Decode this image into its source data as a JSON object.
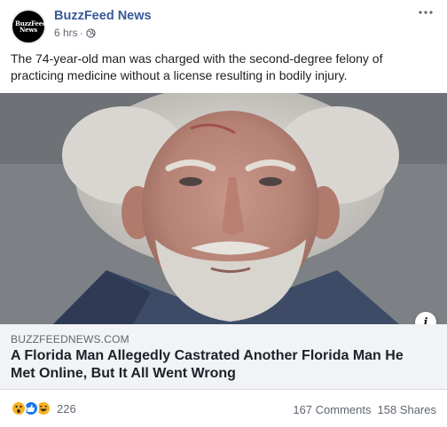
{
  "post": {
    "page_name": "BuzzFeed News",
    "avatar_text": "BuzzFeed News",
    "time": "6 hrs",
    "separator": "·",
    "audience_icon": "globe-icon",
    "more_icon": "more-options-icon",
    "caption": "The 74-year-old man was charged with the second-degree felony of practicing medicine without a license resulting in bodily injury."
  },
  "link": {
    "domain": "BUZZFEEDNEWS.COM",
    "title": "A Florida Man Allegedly Castrated Another Florida Man He Met Online, But It All Went Wrong",
    "info_icon": "i"
  },
  "engagement": {
    "reactions": [
      "wow",
      "like",
      "haha"
    ],
    "reaction_count": "226",
    "comments": "167 Comments",
    "shares": "158 Shares"
  },
  "colors": {
    "page_name": "#385898",
    "meta_text": "#616770",
    "link_background": "#f2f3f5",
    "like_blue": "#1877f2",
    "emoji_yellow": "#f7b125"
  }
}
